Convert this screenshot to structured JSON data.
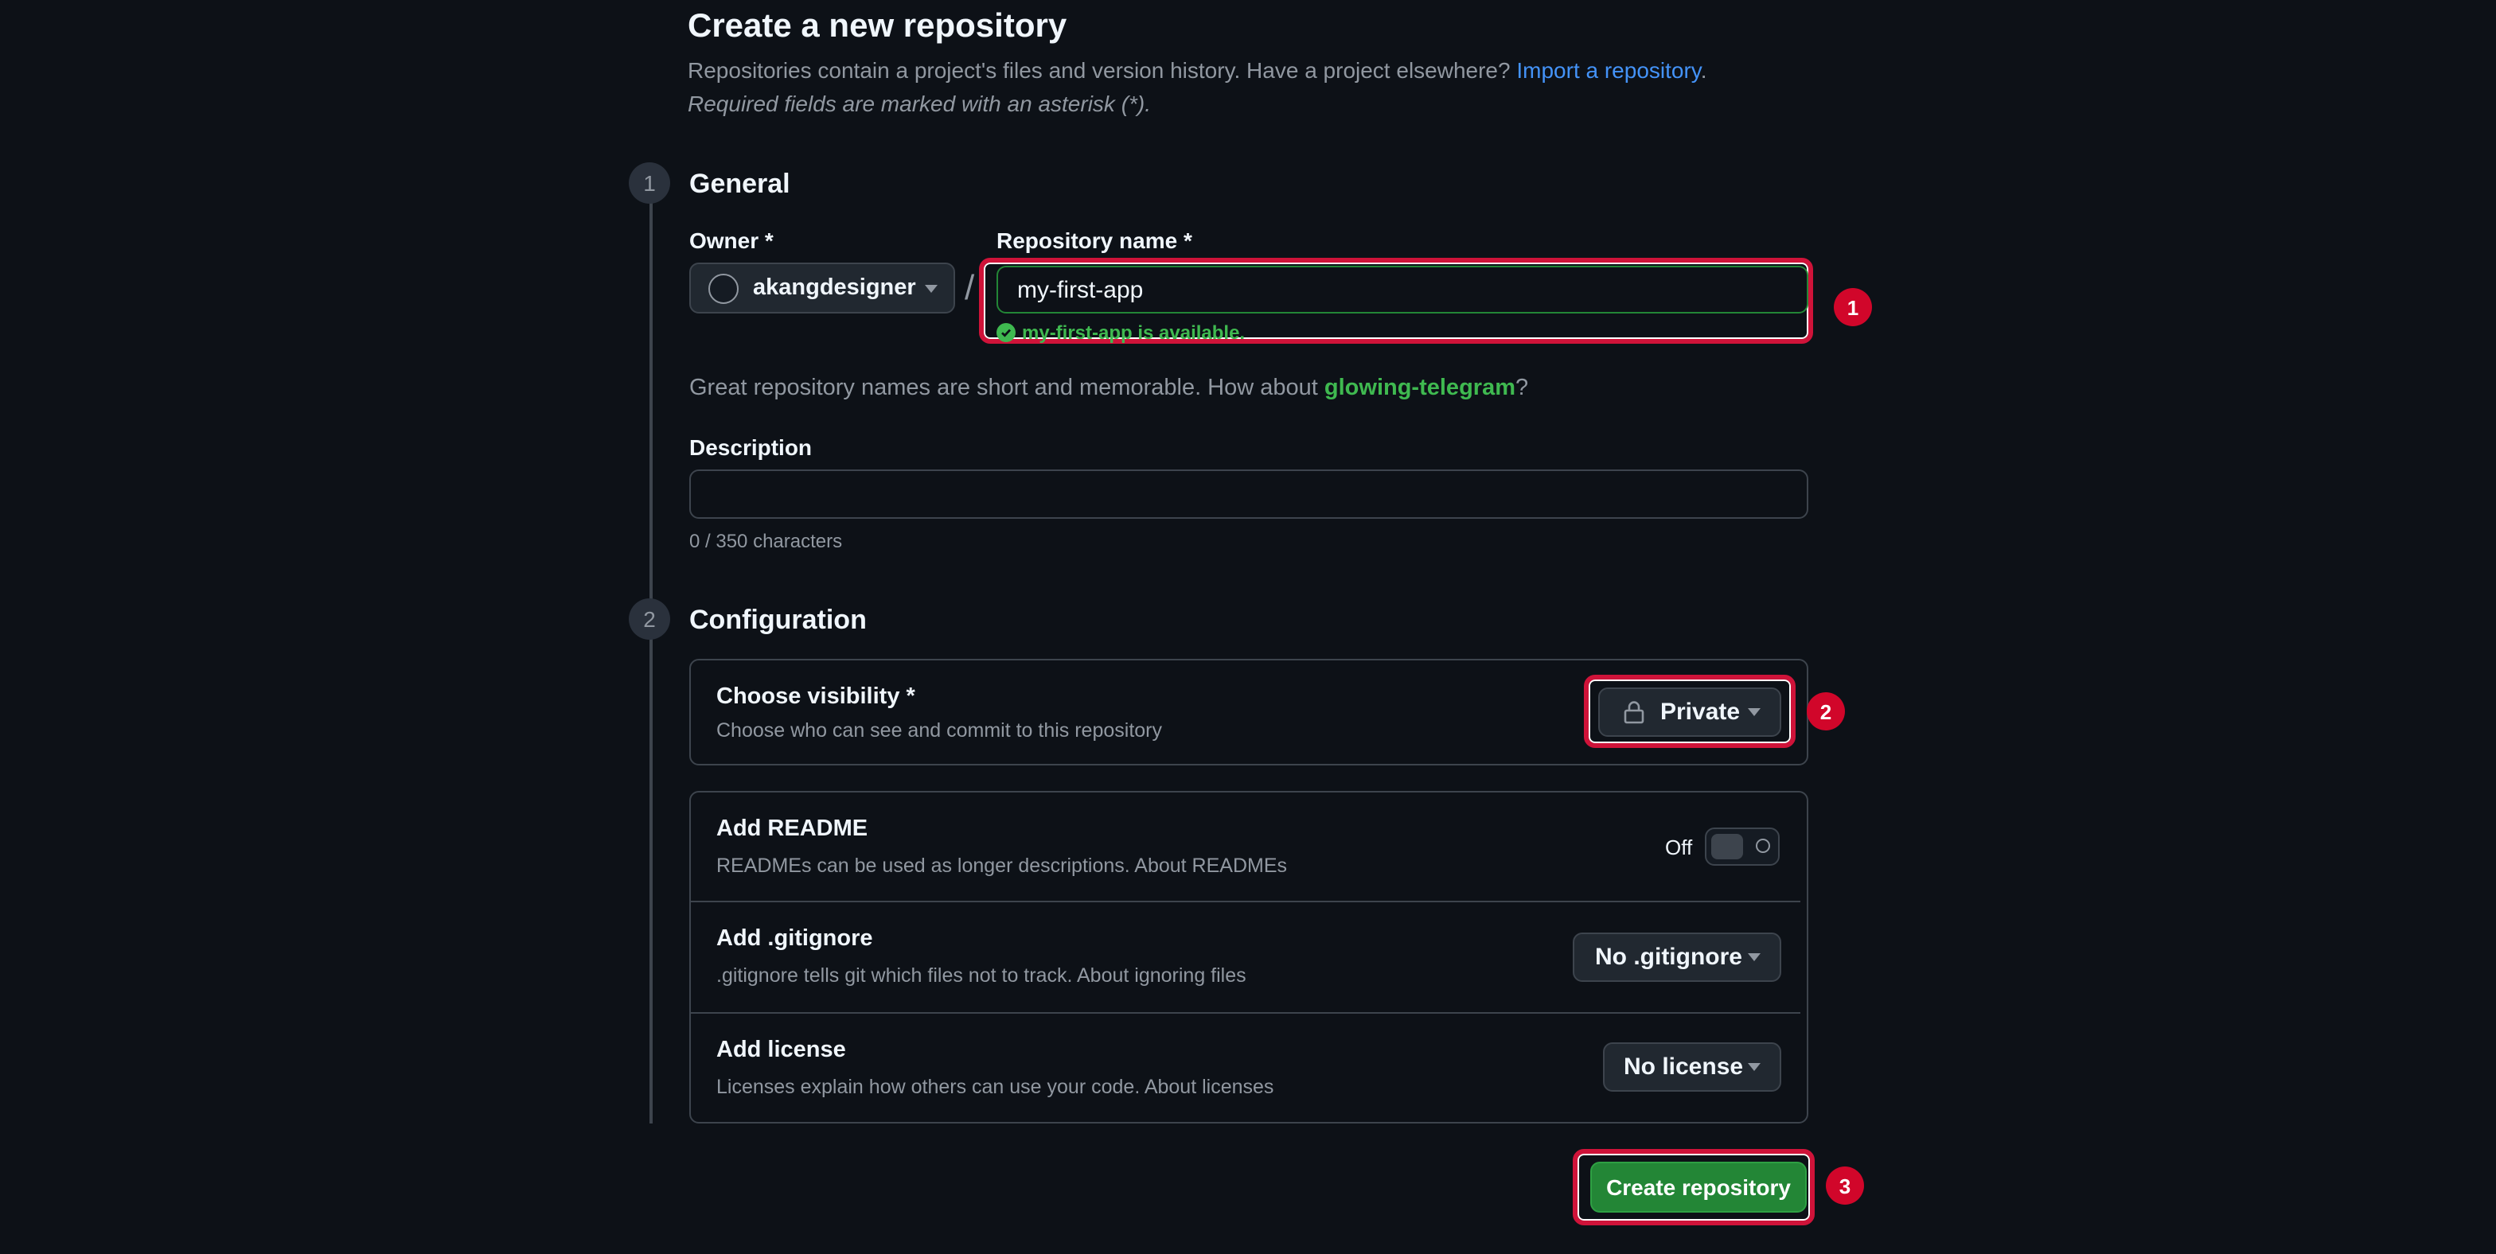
{
  "header": {
    "title": "Create a new repository",
    "subtitle": "Repositories contain a project's files and version history. Have a project elsewhere?",
    "import_link": "Import a repository",
    "subtitle_end": ".",
    "required_note": "Required fields are marked with an asterisk (*)."
  },
  "general": {
    "step": "1",
    "heading": "General",
    "owner_label": "Owner *",
    "owner_value": "akangdesigner",
    "slash": "/",
    "repo_name_label": "Repository name *",
    "repo_name_value": "my-first-app",
    "availability_msg": "my-first-app is available.",
    "suggestion_prefix": "Great repository names are short and memorable. How about",
    "suggestion_name": "glowing-telegram",
    "suggestion_suffix": "?",
    "description_label": "Description",
    "description_value": "",
    "char_count": "0 / 350 characters"
  },
  "configuration": {
    "step": "2",
    "heading": "Configuration",
    "visibility": {
      "title": "Choose visibility *",
      "desc": "Choose who can see and commit to this repository",
      "value": "Private",
      "icon": "lock-icon"
    },
    "readme": {
      "title": "Add README",
      "desc": "READMEs can be used as longer descriptions. About READMEs",
      "toggle_label": "Off",
      "state": "off"
    },
    "gitignore": {
      "title": "Add .gitignore",
      "desc": ".gitignore tells git which files not to track. About ignoring files",
      "value": "No .gitignore"
    },
    "license": {
      "title": "Add license",
      "desc": "Licenses explain how others can use your code. About licenses",
      "value": "No license"
    }
  },
  "submit": {
    "label": "Create repository"
  },
  "annotations": [
    "1",
    "2",
    "3"
  ],
  "colors": {
    "background": "#0d1117",
    "success": "#3fb950",
    "link": "#4493f8",
    "primary_button": "#238636",
    "annotation": "#d1062a"
  }
}
